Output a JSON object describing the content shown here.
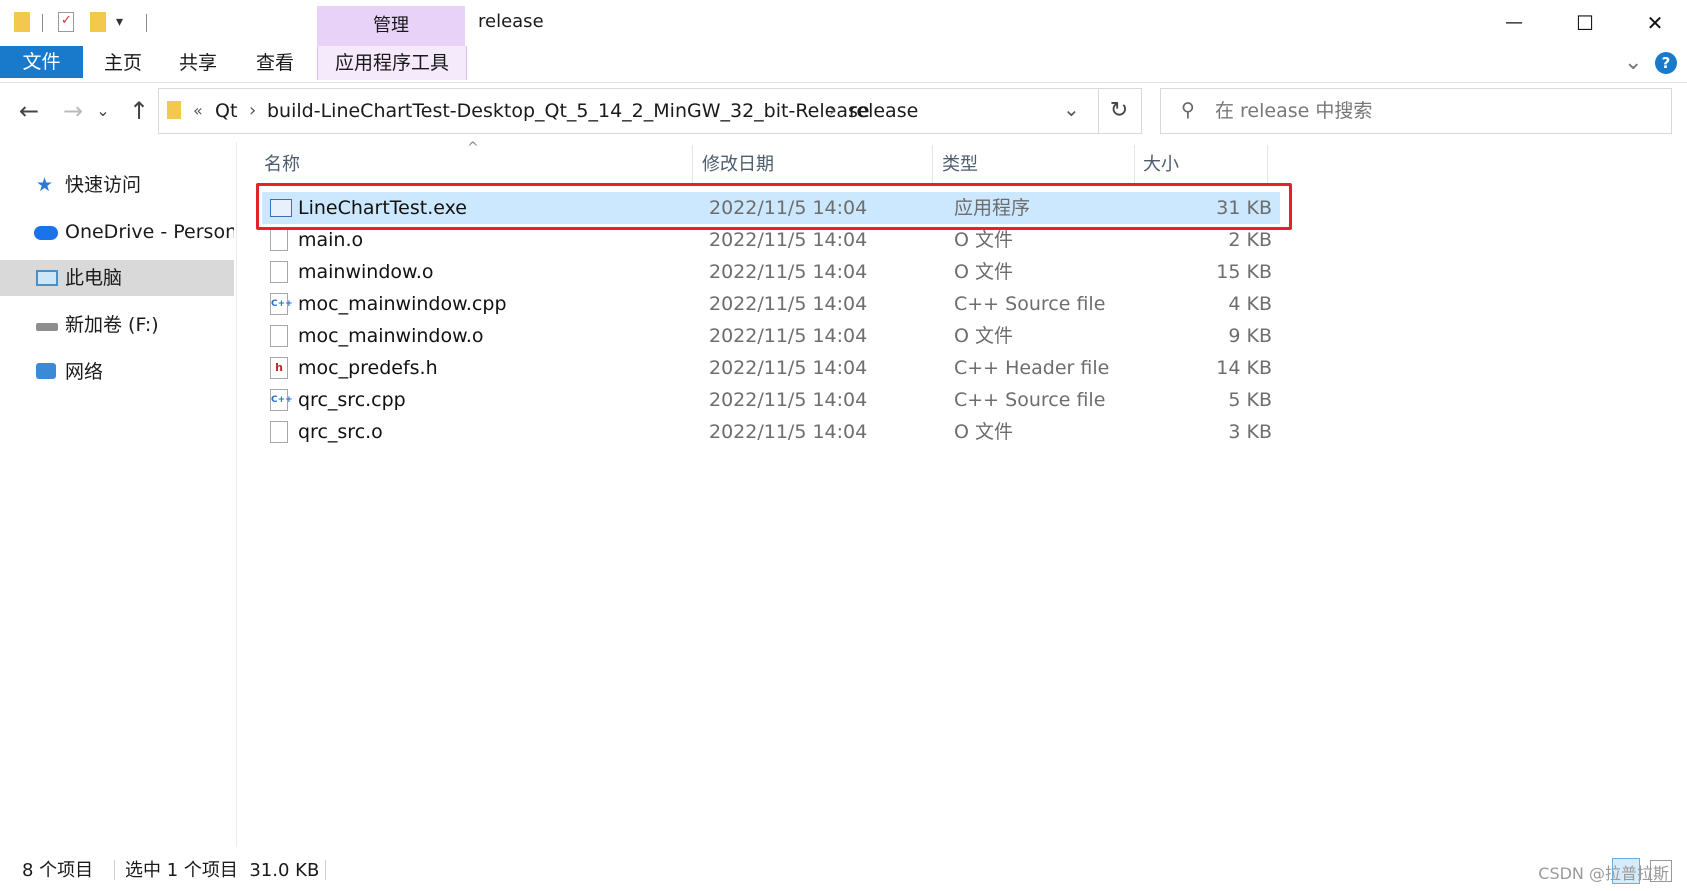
{
  "window": {
    "title": "release",
    "manage_tab": "管理",
    "minimize": "—",
    "maximize": "☐",
    "close": "✕"
  },
  "ribbon": {
    "tabs": [
      "文件",
      "主页",
      "共享",
      "查看",
      "应用程序工具"
    ],
    "help": "?",
    "collapse": "⌄",
    "accent": "#1979ca",
    "context_color": "#e9d2f7"
  },
  "nav": {
    "back": "←",
    "forward": "→",
    "recent": "⌄",
    "up": "↑",
    "breadcrumb_overflow": "«",
    "breadcrumbs": [
      "Qt",
      "build-LineChartTest-Desktop_Qt_5_14_2_MinGW_32_bit-Release",
      "release"
    ],
    "crumb_separator": "›",
    "refresh": "↻",
    "dropdown": "⌄",
    "search_placeholder": "在 release 中搜索"
  },
  "sidebar": {
    "items": [
      {
        "label": "快速访问",
        "icon": "star-icon"
      },
      {
        "label": "OneDrive - Personal",
        "icon": "onedrive-cloud-icon"
      },
      {
        "label": "此电脑",
        "icon": "this-pc-icon"
      },
      {
        "label": "新加卷 (F:)",
        "icon": "drive-icon"
      },
      {
        "label": "网络",
        "icon": "network-icon"
      }
    ],
    "selected_index": 2
  },
  "file_list": {
    "columns": [
      "名称",
      "修改日期",
      "类型",
      "大小"
    ],
    "sort_indicator": "^",
    "files": [
      {
        "name": "LineChartTest.exe",
        "date": "2022/11/5 14:04",
        "type": "应用程序",
        "size": "31 KB",
        "icon": "exe-icon"
      },
      {
        "name": "main.o",
        "date": "2022/11/5 14:04",
        "type": "O 文件",
        "size": "2 KB",
        "icon": "blank-file-icon"
      },
      {
        "name": "mainwindow.o",
        "date": "2022/11/5 14:04",
        "type": "O 文件",
        "size": "15 KB",
        "icon": "blank-file-icon"
      },
      {
        "name": "moc_mainwindow.cpp",
        "date": "2022/11/5 14:04",
        "type": "C++ Source file",
        "size": "4 KB",
        "icon": "cpp-file-icon"
      },
      {
        "name": "moc_mainwindow.o",
        "date": "2022/11/5 14:04",
        "type": "O 文件",
        "size": "9 KB",
        "icon": "blank-file-icon"
      },
      {
        "name": "moc_predefs.h",
        "date": "2022/11/5 14:04",
        "type": "C++ Header file",
        "size": "14 KB",
        "icon": "header-file-icon"
      },
      {
        "name": "qrc_src.cpp",
        "date": "2022/11/5 14:04",
        "type": "C++ Source file",
        "size": "5 KB",
        "icon": "cpp-file-icon"
      },
      {
        "name": "qrc_src.o",
        "date": "2022/11/5 14:04",
        "type": "O 文件",
        "size": "3 KB",
        "icon": "blank-file-icon"
      }
    ],
    "selected_index": 0,
    "selection_color": "#cce8ff",
    "highlight_color": "#e8202e"
  },
  "status": {
    "item_count": "8 个项目",
    "selection": "选中 1 个项目  31.0 KB"
  },
  "watermark": "CSDN @拉普拉斯"
}
